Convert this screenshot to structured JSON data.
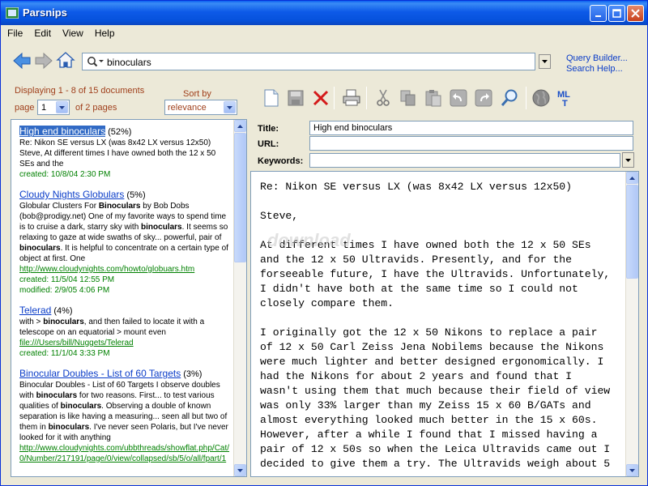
{
  "window": {
    "title": "Parsnips"
  },
  "menu": [
    "File",
    "Edit",
    "View",
    "Help"
  ],
  "search": {
    "query": "binoculars"
  },
  "links": {
    "query_builder": "Query Builder...",
    "search_help": "Search Help..."
  },
  "results_header": {
    "displaying": "Displaying 1 - 8 of 15 documents",
    "page_label": "page",
    "page_value": "1",
    "of_pages": "of 2 pages",
    "sort_label": "Sort by",
    "sort_value": "relevance"
  },
  "results": [
    {
      "title": "High end binoculars",
      "score": "(52%)",
      "snippet_parts": [
        {
          "t": "Re: Nikon SE versus LX (was 8x42 LX versus 12x50) Steve, At different times I have owned both the 12 x 50 SEs and the ",
          "b": false
        }
      ],
      "url": "",
      "meta": [
        "created:   10/8/04 2:30 PM"
      ]
    },
    {
      "title": "Cloudy Nights Globulars",
      "score": "(5%)",
      "snippet_parts": [
        {
          "t": "Globular Clusters For ",
          "b": false
        },
        {
          "t": "Binoculars",
          "b": true
        },
        {
          "t": " by Bob Dobs (bob@prodigy.net) One of my favorite ways to spend time is to cruise a dark, starry sky with ",
          "b": false
        },
        {
          "t": "binoculars",
          "b": true
        },
        {
          "t": ". It seems so relaxing to gaze at wide swaths of sky... powerful, pair of ",
          "b": false
        },
        {
          "t": "binoculars",
          "b": true
        },
        {
          "t": ". It is helpful to concentrate on a certain type of object at first. One",
          "b": false
        }
      ],
      "url": "http://www.cloudynights.com/howto/globuars.htm",
      "meta": [
        "created:   11/5/04 12:55 PM",
        "modified:  2/9/05 4:06 PM"
      ]
    },
    {
      "title": "Telerad",
      "score": "(4%)",
      "snippet_parts": [
        {
          "t": "with > ",
          "b": false
        },
        {
          "t": "binoculars",
          "b": true
        },
        {
          "t": ", and then failed to locate it with a telescope on an equatorial > mount even",
          "b": false
        }
      ],
      "url": "file:///Users/bill/Nuggets/Telerad",
      "meta": [
        "created:   11/1/04 3:33 PM"
      ]
    },
    {
      "title": "Binocular Doubles - List of 60 Targets",
      "score": "(3%)",
      "snippet_parts": [
        {
          "t": "Binocular Doubles - List of 60 Targets I observe doubles with ",
          "b": false
        },
        {
          "t": "binoculars",
          "b": true
        },
        {
          "t": " for two reasons. First... to test various qualities of ",
          "b": false
        },
        {
          "t": "binoculars",
          "b": true
        },
        {
          "t": ". Observing a double of known separation is like having a measuring... seen all but two of them in ",
          "b": false
        },
        {
          "t": "binoculars",
          "b": true
        },
        {
          "t": ". I've never seen Polaris, but I've never looked for it with anything",
          "b": false
        }
      ],
      "url": "http://www.cloudynights.com/ubbthreads/showflat.php/Cat/0/Number/217191/page/0/view/collapsed/sb/5/o/all/fpart/1",
      "meta": []
    }
  ],
  "fields": {
    "title_label": "Title:",
    "title_value": "High end binoculars",
    "url_label": "URL:",
    "url_value": "",
    "keywords_label": "Keywords:",
    "keywords_value": ""
  },
  "toolbar": {
    "mlt_label": "ML\nT"
  },
  "document": {
    "body": "Re: Nikon SE versus LX (was 8x42 LX versus 12x50)\n\nSteve,\n\nAt different times I have owned both the 12 x 50 SEs\nand the 12 x 50 Ultravids. Presently, and for the\nforseeable future, I have the Ultravids. Unfortunately,\nI didn't have both at the same time so I could not\nclosely compare them.\n\nI originally got the 12 x 50 Nikons to replace a pair\nof 12 x 50 Carl Zeiss Jena Nobilems because the Nikons\nwere much lighter and better designed ergonomically. I\nhad the Nikons for about 2 years and found that I\nwasn't using them that much because their field of view\nwas only 33% larger than my Zeiss 15 x 60 B/GATs and\nalmost everything looked much better in the 15 x 60s.\nHowever, after a while I found that I missed having a\npair of 12 x 50s so when the Leica Ultravids came out I\ndecided to give them a try. The Ultravids weigh about 5",
    "watermark": "download"
  },
  "colors": {
    "title_bar": "#0b5ae6",
    "link": "#0a3cc8",
    "date": "#008000",
    "header_text": "#a0401c"
  }
}
